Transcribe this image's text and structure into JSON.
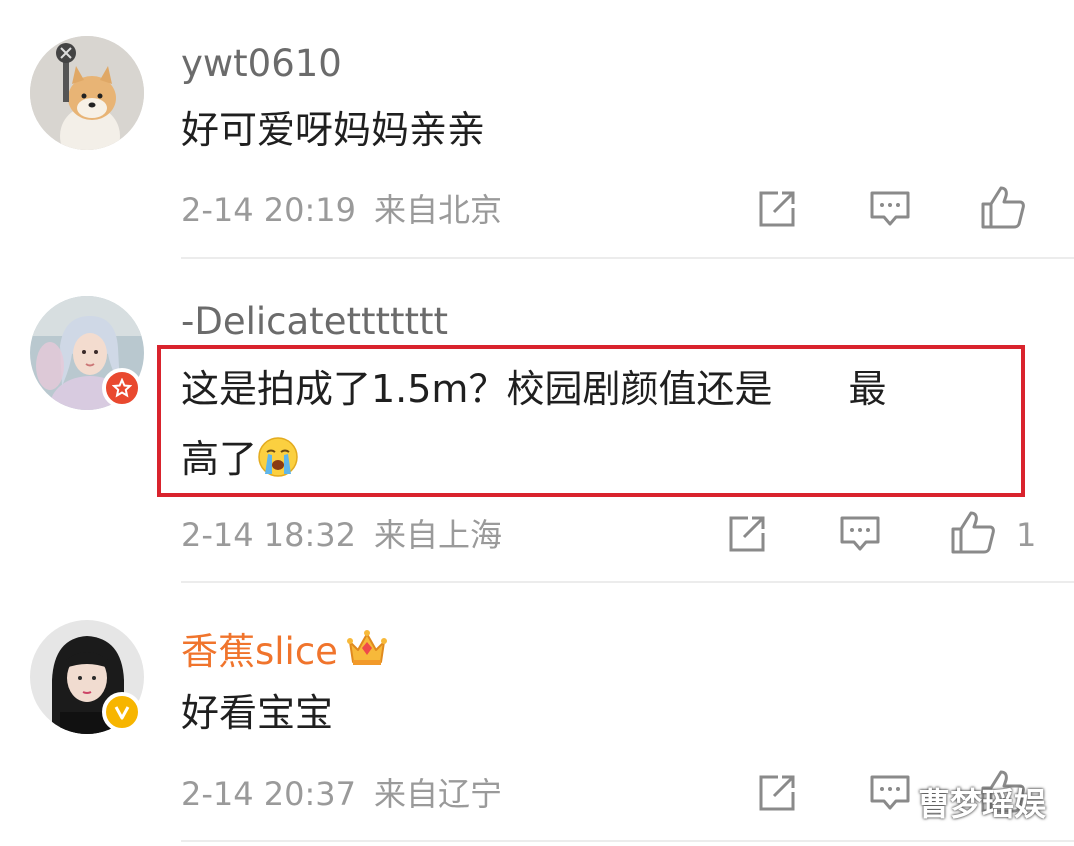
{
  "comments": [
    {
      "username": "ywt0610",
      "text": "好可爱呀妈妈亲亲",
      "time": "2-14 20:19",
      "location": "来自北京",
      "likes": ""
    },
    {
      "username": "-Delicatettttttt",
      "text_line1": "这是拍成了1.5m？校园剧颜值还是",
      "text_line1_tail": "最",
      "text_line2": "高了",
      "time": "2-14 18:32",
      "location": "来自上海",
      "likes": "1"
    },
    {
      "username": "香蕉slice",
      "text": "好看宝宝",
      "time": "2-14 20:37",
      "location": "来自辽宁",
      "likes": ""
    }
  ],
  "watermark": "曹梦瑶娱",
  "colors": {
    "highlight": "#d9232d",
    "vip_name": "#f0742c",
    "meta": "#9a9a9a",
    "icon": "#8a8a8a"
  },
  "icons": {
    "share": "share-icon",
    "comment": "comment-icon",
    "like": "thumbs-up-icon"
  }
}
